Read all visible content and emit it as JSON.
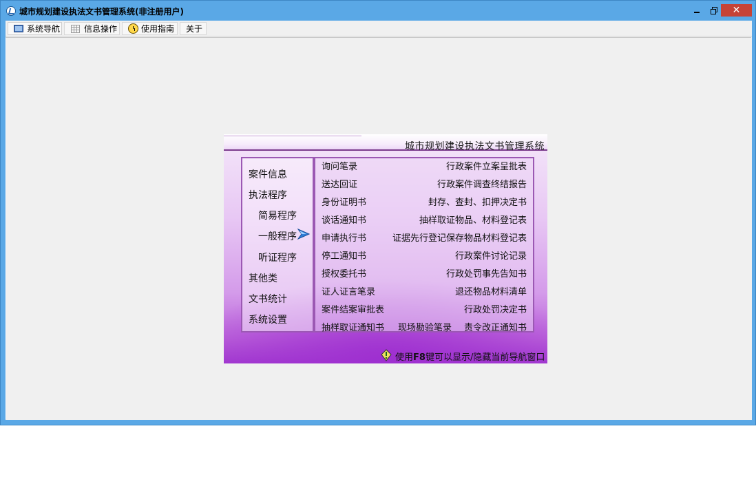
{
  "window": {
    "title": "城市规划建设执法文书管理系统(非注册用户)",
    "close_glyph": "✕"
  },
  "menubar": {
    "items": [
      {
        "label": "系统导航",
        "icon": "monitor-icon"
      },
      {
        "label": "信息操作",
        "icon": "grid-icon"
      },
      {
        "label": "使用指南",
        "icon": "smiley-icon"
      },
      {
        "label": "关于"
      }
    ]
  },
  "nav": {
    "title": "城市规划建设执法文书管理系统",
    "categories": [
      {
        "label": "案件信息"
      },
      {
        "label": "执法程序"
      },
      {
        "label": "简易程序"
      },
      {
        "label": "一般程序",
        "active": true
      },
      {
        "label": "听证程序"
      },
      {
        "label": "其他类"
      },
      {
        "label": "文书统计"
      },
      {
        "label": "系统设置"
      }
    ],
    "documents_left": [
      "询问笔录",
      "送达回证",
      "身份证明书",
      "谈话通知书",
      "申请执行书",
      "停工通知书",
      "授权委托书",
      "证人证言笔录",
      "案件结案审批表",
      "抽样取证通知书"
    ],
    "documents_right": [
      "行政案件立案呈批表",
      "行政案件调查终结报告",
      "封存、查封、扣押决定书",
      "抽样取证物品、材料登记表",
      "证据先行登记保存物品材料登记表",
      "行政案件讨论记录",
      "行政处罚事先告知书",
      "退还物品材料清单",
      "行政处罚决定书",
      "责令改正通知书"
    ],
    "document_middle": "现场勘验笔录",
    "hint_prefix": "使用",
    "hint_key": "F8",
    "hint_suffix": "键可以显示/隐藏当前导航窗口"
  },
  "colors": {
    "titlebar": "#5aa8e6",
    "close_button": "#c64337",
    "panel_border": "#9b58b3",
    "panel_bottom": "#a23ad0"
  }
}
